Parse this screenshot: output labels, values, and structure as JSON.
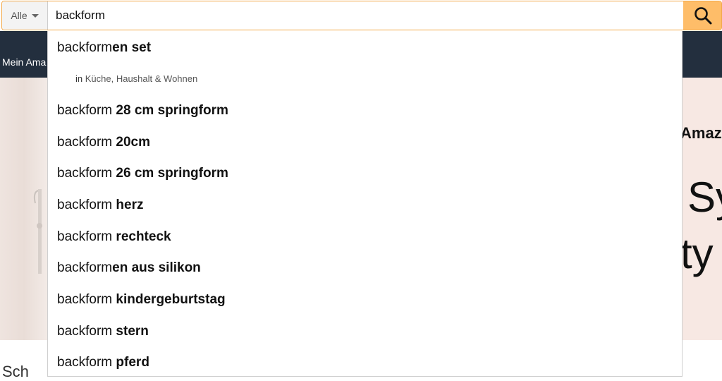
{
  "search": {
    "department": "Alle",
    "query": "backform",
    "search_icon": "magnifier-icon",
    "accent_color": "#febd69",
    "border_color": "#f3a847"
  },
  "nav": {
    "partial_text": "Mein Ama",
    "background": "#232f3e"
  },
  "hero": {
    "right_text_1": "Amaz",
    "right_text_2": "Sy",
    "right_text_3": "ty",
    "below_peek": "Sch"
  },
  "suggestions": [
    {
      "prefix": "backform",
      "suffix": "en set"
    },
    {
      "prefix": "backform ",
      "suffix": "28 cm springform"
    },
    {
      "prefix": "backform ",
      "suffix": "20cm"
    },
    {
      "prefix": "backform ",
      "suffix": "26 cm springform"
    },
    {
      "prefix": "backform ",
      "suffix": "herz"
    },
    {
      "prefix": "backform ",
      "suffix": "rechteck"
    },
    {
      "prefix": "backform",
      "suffix": "en aus silikon"
    },
    {
      "prefix": "backform ",
      "suffix": "kindergeburtstag"
    },
    {
      "prefix": "backform ",
      "suffix": "stern"
    },
    {
      "prefix": "backform ",
      "suffix": "pferd"
    }
  ],
  "scope": {
    "in_label": "in",
    "category": "Küche, Haushalt & Wohnen"
  }
}
